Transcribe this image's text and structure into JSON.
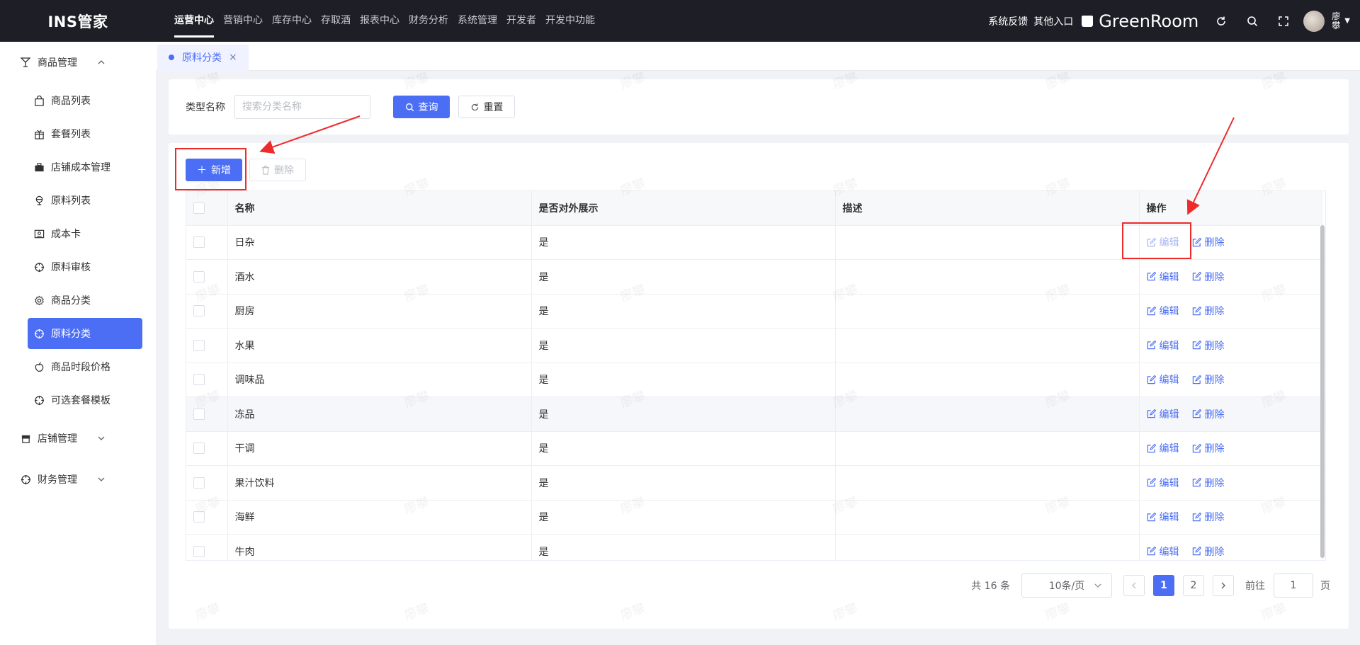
{
  "app": {
    "title": "INS管家"
  },
  "topnav": {
    "items": [
      "运营中心",
      "营销中心",
      "库存中心",
      "存取酒",
      "报表中心",
      "财务分析",
      "系统管理",
      "开发者",
      "开发中功能"
    ],
    "active": "运营中心"
  },
  "header_right": {
    "feedback": "系统反馈",
    "other_entry": "其他入口",
    "store_name": "GreenRoom",
    "user_name_line1": "廖",
    "user_name_line2": "攀"
  },
  "sidebar": {
    "groups": [
      {
        "label": "商品管理",
        "expanded": true,
        "items": [
          "商品列表",
          "套餐列表",
          "店铺成本管理",
          "原料列表",
          "成本卡",
          "原料审核",
          "商品分类",
          "原料分类",
          "商品时段价格",
          "可选套餐模板"
        ]
      },
      {
        "label": "店铺管理",
        "expanded": false
      },
      {
        "label": "财务管理",
        "expanded": false
      }
    ],
    "active_item": "原料分类"
  },
  "tabs": [
    {
      "label": "原料分类",
      "active": true
    }
  ],
  "search": {
    "label": "类型名称",
    "placeholder": "搜索分类名称",
    "query_button": "查询",
    "reset_button": "重置"
  },
  "toolbar": {
    "add_button": "新增",
    "delete_button": "删除"
  },
  "table": {
    "columns": [
      "名称",
      "是否对外展示",
      "描述",
      "操作"
    ],
    "rows": [
      {
        "name": "日杂",
        "display": "是",
        "desc": ""
      },
      {
        "name": "酒水",
        "display": "是",
        "desc": ""
      },
      {
        "name": "厨房",
        "display": "是",
        "desc": ""
      },
      {
        "name": "水果",
        "display": "是",
        "desc": ""
      },
      {
        "name": "调味品",
        "display": "是",
        "desc": ""
      },
      {
        "name": "冻品",
        "display": "是",
        "desc": ""
      },
      {
        "name": "干调",
        "display": "是",
        "desc": ""
      },
      {
        "name": "果汁饮料",
        "display": "是",
        "desc": ""
      },
      {
        "name": "海鲜",
        "display": "是",
        "desc": ""
      },
      {
        "name": "牛肉",
        "display": "是",
        "desc": ""
      }
    ],
    "edit_label": "编辑",
    "delete_label": "删除"
  },
  "pagination": {
    "total_text": "共 16 条",
    "page_size": "10条/页",
    "pages": [
      "1",
      "2"
    ],
    "current": "1",
    "goto_label": "前往",
    "goto_value": "1",
    "page_suffix": "页"
  },
  "watermark": "廖攀",
  "colors": {
    "primary": "#4b6ef5",
    "topbar": "#1d1e26",
    "annotation": "#ee2b2b"
  }
}
